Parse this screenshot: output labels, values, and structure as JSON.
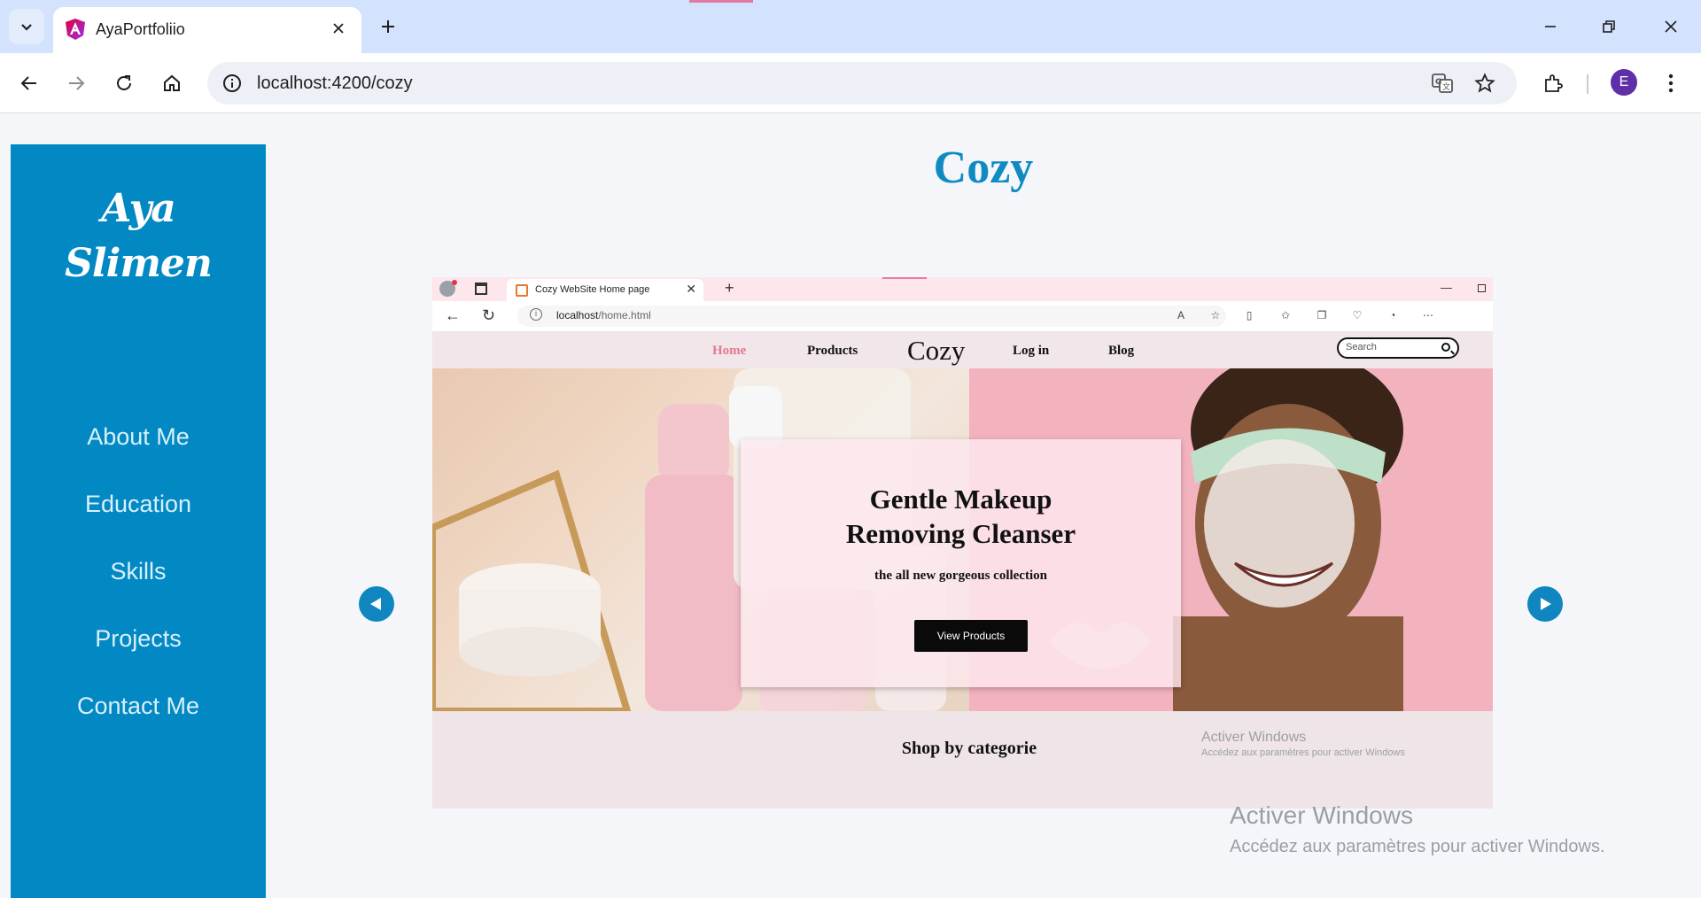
{
  "browser": {
    "tab_title": "AyaPortfoliio",
    "url": "localhost:4200/cozy",
    "profile_initial": "E"
  },
  "sidebar": {
    "logo_line1": "Aya",
    "logo_line2": "Slimen",
    "nav": [
      "About Me",
      "Education",
      "Skills",
      "Projects",
      "Contact Me"
    ]
  },
  "page": {
    "title": "Cozy"
  },
  "slide": {
    "tab_title": "Cozy WebSite Home page",
    "url_host": "localhost",
    "url_path": "/home.html",
    "nav": {
      "home": "Home",
      "products": "Products",
      "brand": "Cozy",
      "login": "Log in",
      "blog": "Blog"
    },
    "search_placeholder": "Search",
    "hero_title_line1": "Gentle Makeup",
    "hero_title_line2": "Removing Cleanser",
    "hero_subtitle": "the all new gorgeous collection",
    "hero_button": "View Products",
    "section_title": "Shop by categorie",
    "activate_title": "Activer Windows",
    "activate_sub": "Accédez aux paramètres pour activer Windows"
  },
  "watermark": {
    "title": "Activer Windows",
    "subtitle": "Accédez aux paramètres pour activer Windows."
  },
  "colors": {
    "sidebar": "#0289c3",
    "accent": "#0f8bc2",
    "tabstrip": "#d3e3fd"
  }
}
